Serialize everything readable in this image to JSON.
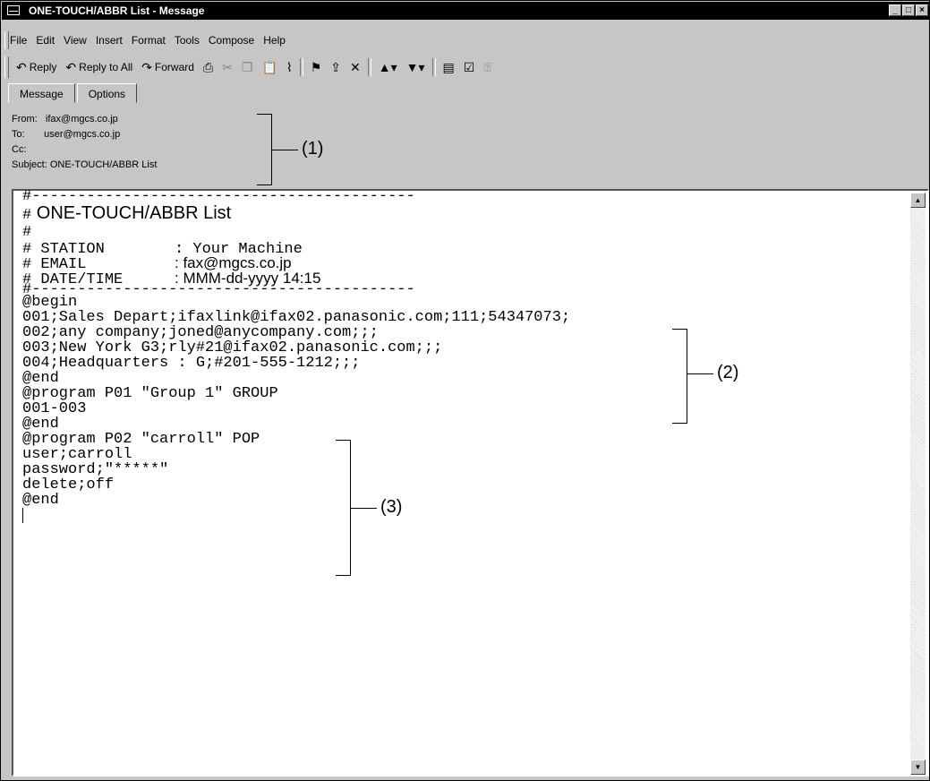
{
  "window": {
    "title": "ONE-TOUCH/ABBR List - Message",
    "controls": [
      "_",
      "□",
      "×"
    ]
  },
  "menu": [
    "File",
    "Edit",
    "View",
    "Insert",
    "Format",
    "Tools",
    "Compose",
    "Help"
  ],
  "toolbar": {
    "reply": "Reply",
    "reply_all": "Reply to All",
    "forward": "Forward"
  },
  "tabs": [
    "Message",
    "Options"
  ],
  "header": {
    "from_label": "From:",
    "from_value": "ifax@mgcs.co.jp",
    "to_label": "To:",
    "to_value": "user@mgcs.co.jp",
    "cc_label": "Cc:",
    "cc_value": "",
    "subject_label": "Subject:",
    "subject_value": "ONE-TOUCH/ABBR List"
  },
  "callouts": [
    "(1)",
    "(2)",
    "(3)"
  ],
  "body": {
    "dash_line": "#------------------------------------------",
    "title": "ONE-TOUCH/ABBR List",
    "hash": "#",
    "station_key": "# STATION",
    "station_val": ": Your Machine",
    "email_key": "# EMAIL",
    "email_val": ": fax@mgcs.co.jp",
    "date_key": "# DATE/TIME",
    "date_val": ": MMM-dd-yyyy 14:15",
    "lines": [
      "@begin",
      "001;Sales Depart;ifaxlink@ifax02.panasonic.com;111;54347073;",
      "002;any company;joned@anycompany.com;;;",
      "003;New York G3;rly#21@ifax02.panasonic.com;;;",
      "004;Headquarters : G;#201-555-1212;;;",
      "@end",
      "@program P01 \"Group 1\" GROUP",
      "001-003",
      "@end",
      "@program P02 \"carroll\" POP",
      "user;carroll",
      "password;\"*****\"",
      "delete;off",
      "@end"
    ]
  }
}
